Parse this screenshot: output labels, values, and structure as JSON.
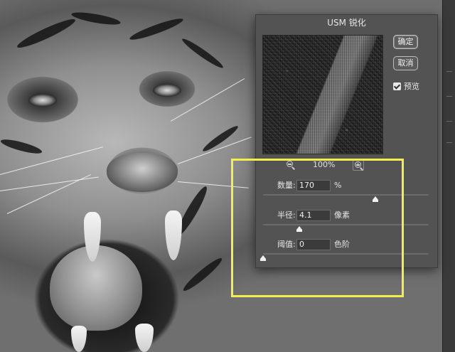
{
  "dialog": {
    "title": "USM 锐化",
    "ok_label": "确定",
    "cancel_label": "取消",
    "preview_label": "预览",
    "preview_checked": true,
    "zoom_label": "100%"
  },
  "params": {
    "amount": {
      "label": "数量:",
      "value": "170",
      "unit": "%",
      "slider_fraction": 0.68
    },
    "radius": {
      "label": "半径:",
      "value": "4.1",
      "unit": "像素",
      "slider_fraction": 0.22
    },
    "threshold": {
      "label": "阈值:",
      "value": "0",
      "unit": "色阶",
      "slider_fraction": 0.0
    }
  },
  "colors": {
    "highlight": "#f3ee4a",
    "dialog_bg": "#535353"
  },
  "icons": [
    "zoom-out-icon",
    "zoom-in-icon",
    "checkmark-icon"
  ]
}
